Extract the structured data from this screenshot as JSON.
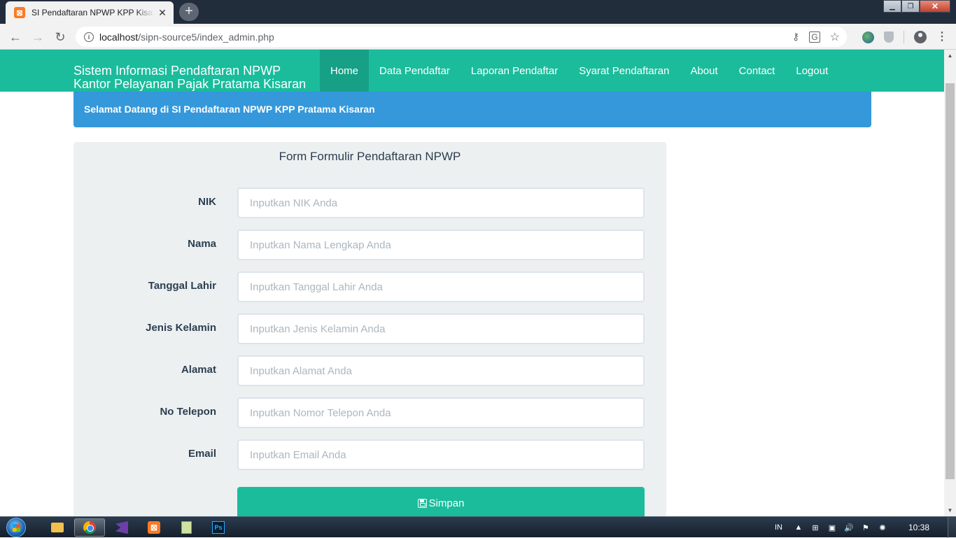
{
  "browser": {
    "tab_title": "SI Pendaftaran NPWP KPP Kisaran",
    "tab_favicon_letter": "⊠",
    "url_host": "localhost",
    "url_path": "/sipn-source5/index_admin.php",
    "window_controls": {
      "minimize": "▁",
      "maximize": "❐",
      "close": "✕"
    }
  },
  "site": {
    "brand_line1": "Sistem Informasi Pendaftaran NPWP",
    "brand_line2": "Kantor Pelayanan Pajak Pratama Kisaran",
    "menu": [
      "Home",
      "Data Pendaftar",
      "Laporan Pendaftar",
      "Syarat Pendaftaran",
      "About",
      "Contact",
      "Logout"
    ],
    "active_menu": "Home",
    "welcome": "Selamat Datang di SI Pendaftaran NPWP KPP Pratama Kisaran"
  },
  "form": {
    "title": "Form Formulir Pendaftaran NPWP",
    "fields": [
      {
        "label": "NIK",
        "placeholder": "Inputkan NIK Anda"
      },
      {
        "label": "Nama",
        "placeholder": "Inputkan Nama Lengkap Anda"
      },
      {
        "label": "Tanggal Lahir",
        "placeholder": "Inputkan Tanggal Lahir Anda"
      },
      {
        "label": "Jenis Kelamin",
        "placeholder": "Inputkan Jenis Kelamin Anda"
      },
      {
        "label": "Alamat",
        "placeholder": "Inputkan Alamat Anda"
      },
      {
        "label": "No Telepon",
        "placeholder": "Inputkan Nomor Telepon Anda"
      },
      {
        "label": "Email",
        "placeholder": "Inputkan Email Anda"
      }
    ],
    "submit_label": "Simpan"
  },
  "taskbar": {
    "language": "IN",
    "time": "10:38"
  },
  "colors": {
    "primary": "#1abc9c",
    "primary_active": "#16a085",
    "info": "#3498db",
    "form_bg": "#ecf0f1",
    "text": "#2c3e50"
  }
}
